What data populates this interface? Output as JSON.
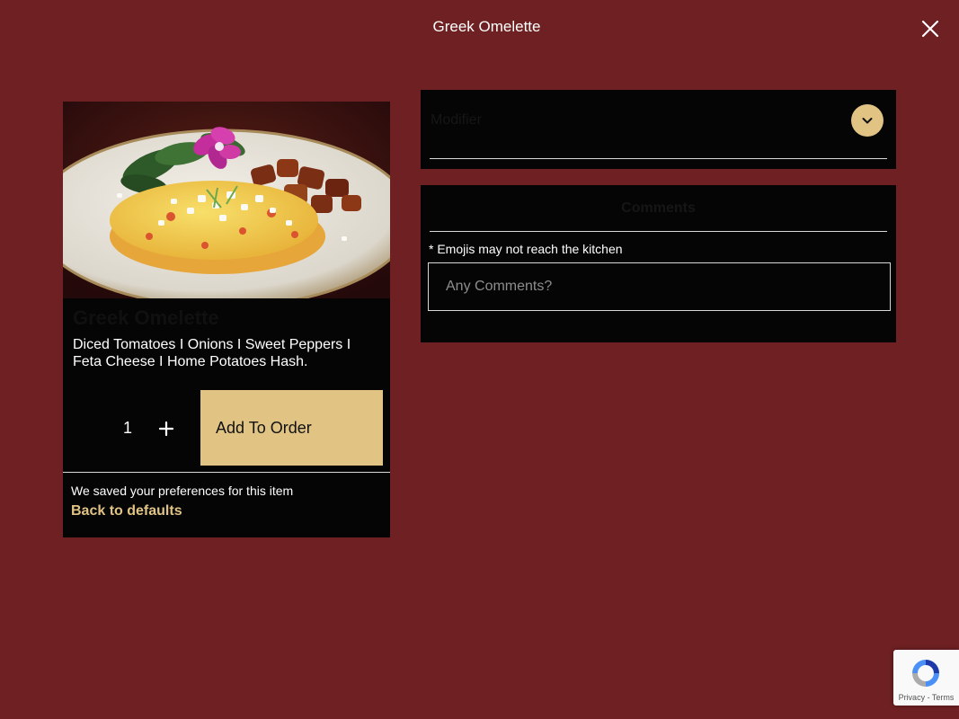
{
  "modal": {
    "title": "Greek Omelette"
  },
  "item": {
    "name": "Greek Omelette",
    "description": "Diced Tomatoes I Onions I Sweet Peppers I Feta Cheese I Home Potatoes Hash.",
    "quantity": "1",
    "add_label": "Add To Order",
    "saved_note": "We saved your preferences for this item",
    "defaults_label": "Back to defaults"
  },
  "modifier": {
    "label": "Modifier"
  },
  "comments": {
    "heading": "Comments",
    "emoji_note": "* Emojis may not reach the kitchen",
    "placeholder": "Any Comments?"
  },
  "recaptcha": {
    "privacy": "Privacy",
    "separator": " - ",
    "terms": "Terms"
  },
  "colors": {
    "background": "#6e2022",
    "panel": "#050505",
    "accent": "#e1c384"
  },
  "icons": {
    "close": "close-icon",
    "plus": "plus-icon",
    "chevron": "chevron-down-icon",
    "recaptcha": "recaptcha-icon"
  }
}
